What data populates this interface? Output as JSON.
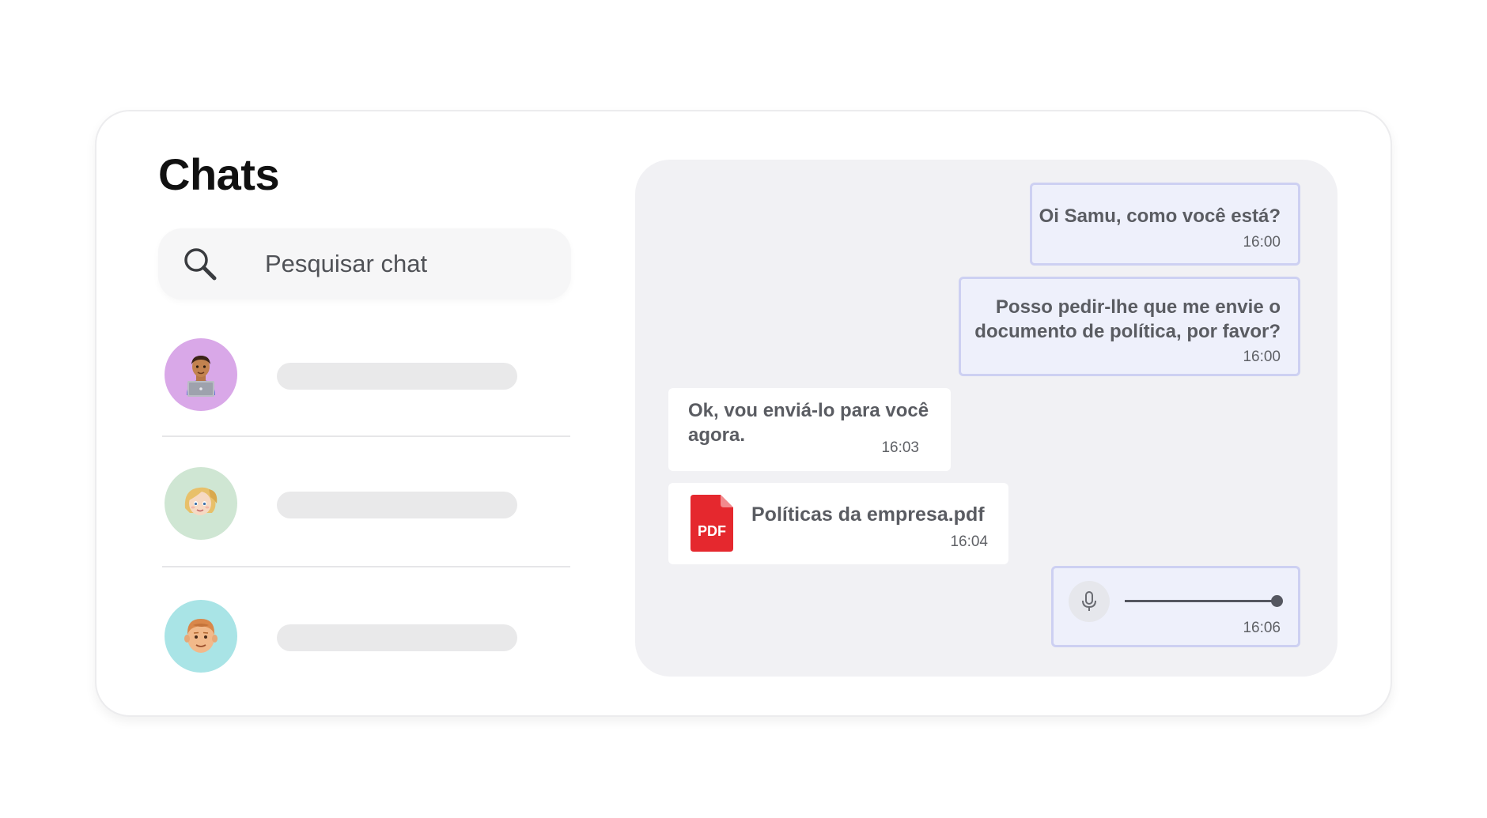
{
  "sidebar": {
    "title": "Chats",
    "search": {
      "placeholder": "Pesquisar chat",
      "icon": "search-icon"
    },
    "contacts": [
      {
        "avatar_icon": "technologist-emoji",
        "avatar_bg": "#d9a8e8"
      },
      {
        "avatar_icon": "blonde-woman-emoji",
        "avatar_bg": "#cfe6d3"
      },
      {
        "avatar_icon": "redhead-man-emoji",
        "avatar_bg": "#a9e4e6"
      }
    ]
  },
  "conversation": {
    "messages": [
      {
        "direction": "out",
        "text": "Oi Samu, como você está?",
        "time": "16:00"
      },
      {
        "direction": "out",
        "text_line1": "Posso pedir-lhe que me envie o",
        "text_line2": "documento de política, por favor?",
        "time": "16:00"
      },
      {
        "direction": "in",
        "text_line1": "Ok, vou enviá-lo para você",
        "text_line2": "agora.",
        "time": "16:03"
      },
      {
        "direction": "in",
        "type": "file",
        "file_icon": "pdf-icon",
        "file_badge": "PDF",
        "file_name": "Políticas da empresa.pdf",
        "time": "16:04"
      },
      {
        "direction": "out",
        "type": "audio",
        "icon": "microphone-icon",
        "progress": 1.0,
        "time": "16:06"
      }
    ]
  },
  "colors": {
    "outgoing_bubble": "#eef0fb",
    "outgoing_border": "#cdd0f2",
    "incoming_bubble": "#ffffff",
    "panel_bg": "#f1f1f4",
    "pdf_red": "#e5282e"
  }
}
